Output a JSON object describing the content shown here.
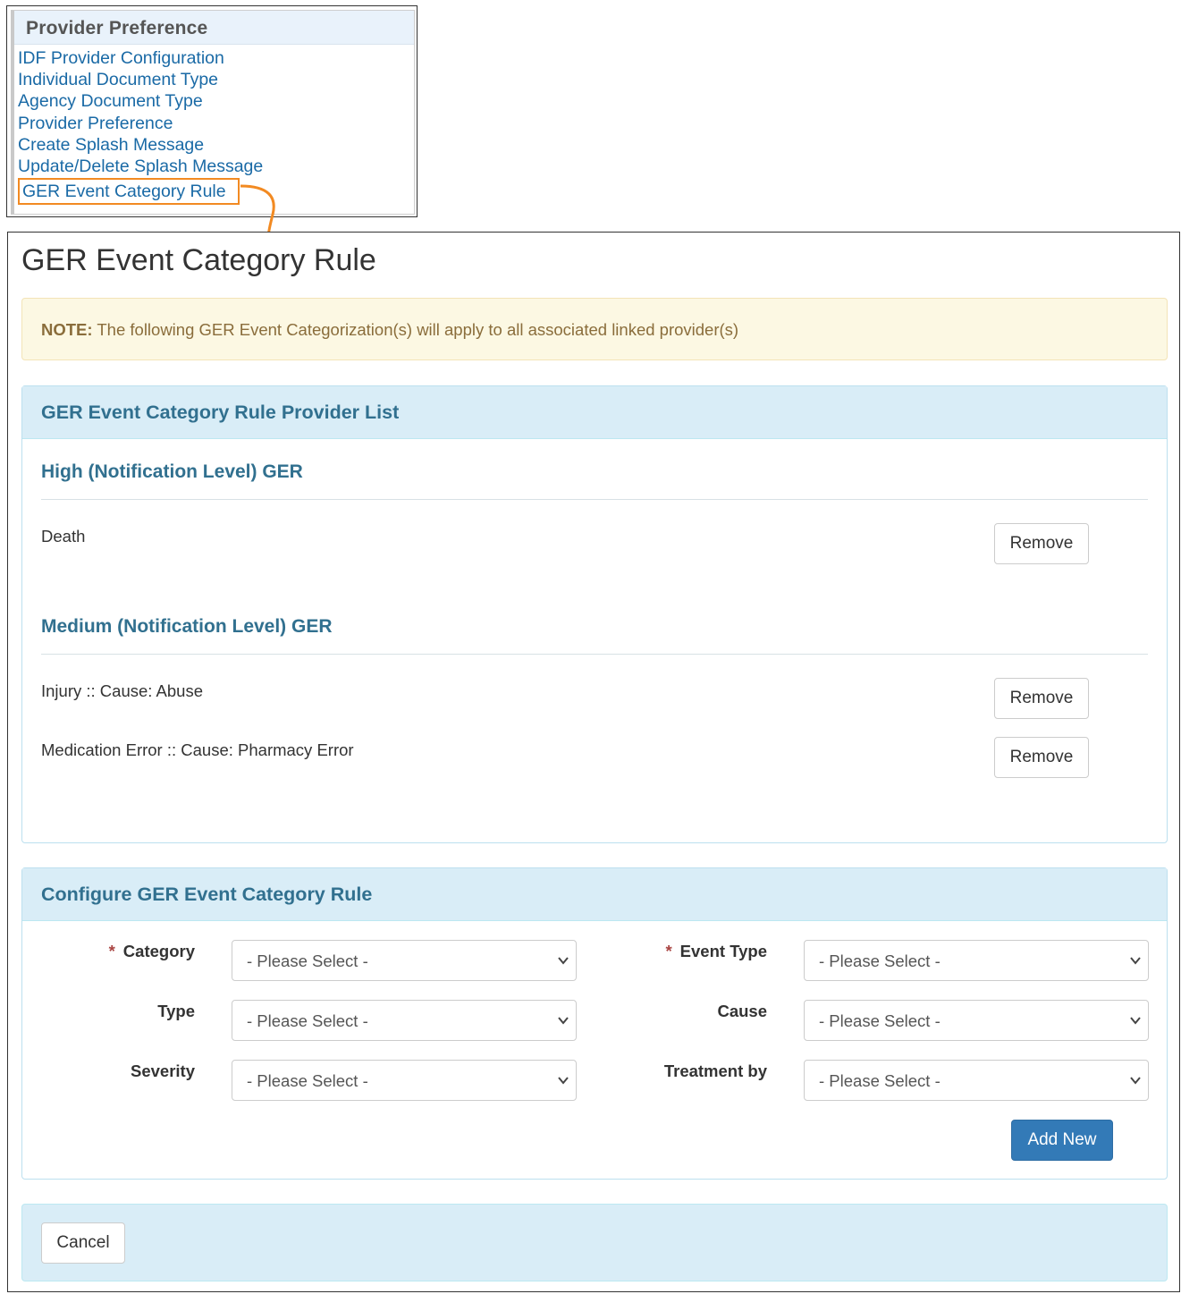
{
  "menu": {
    "header": "Provider Preference",
    "items": [
      "IDF Provider Configuration",
      "Individual Document Type",
      "Agency Document Type",
      "Provider Preference",
      "Create Splash Message",
      "Update/Delete Splash Message",
      "GER Event Category Rule"
    ],
    "highlight_color": "#f28a22"
  },
  "page": {
    "title": "GER Event Category Rule"
  },
  "note": {
    "label": "NOTE:",
    "text": " The following GER Event Categorization(s) will apply to all associated linked provider(s)"
  },
  "provider_list": {
    "title": "GER Event Category Rule Provider List",
    "groups": [
      {
        "heading": "High (Notification Level) GER",
        "items": [
          {
            "text": "Death",
            "action": "Remove"
          }
        ]
      },
      {
        "heading": "Medium (Notification Level) GER",
        "items": [
          {
            "text": "Injury :: Cause: Abuse",
            "action": "Remove"
          },
          {
            "text": "Medication Error :: Cause: Pharmacy Error",
            "action": "Remove"
          }
        ]
      }
    ]
  },
  "configure": {
    "title": "Configure GER Event Category Rule",
    "required_mark": "*",
    "fields": {
      "category": {
        "label": "Category",
        "value": "- Please Select -"
      },
      "event_type": {
        "label": "Event Type",
        "value": "- Please Select -"
      },
      "type": {
        "label": "Type",
        "value": "- Please Select -"
      },
      "cause": {
        "label": "Cause",
        "value": "- Please Select -"
      },
      "severity": {
        "label": "Severity",
        "value": "- Please Select -"
      },
      "treatment_by": {
        "label": "Treatment by",
        "value": "- Please Select -"
      }
    },
    "add_label": "Add New"
  },
  "footer": {
    "cancel_label": "Cancel"
  },
  "colors": {
    "panel_heading_bg": "#d9edf7",
    "panel_heading_text": "#31708f",
    "note_bg": "#fcf8e3",
    "note_text": "#8a6d3b",
    "primary": "#337ab7",
    "link": "#1a6aa6"
  }
}
